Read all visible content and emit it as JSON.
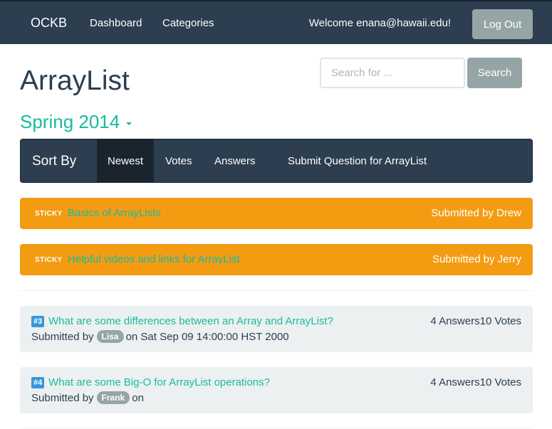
{
  "navbar": {
    "brand": "OCKB",
    "links": [
      "Dashboard",
      "Categories"
    ],
    "welcome": "Welcome enana@hawaii.edu!",
    "logout_label": "Log Out"
  },
  "search": {
    "placeholder": "Search for ...",
    "button_label": "Search"
  },
  "page": {
    "title": "ArrayList",
    "semester": "Spring 2014"
  },
  "sort_bar": {
    "label": "Sort By",
    "options": [
      "Newest",
      "Votes",
      "Answers"
    ],
    "active": "Newest",
    "submit_link": "Submit Question for ArrayList"
  },
  "sticky_posts": [
    {
      "badge": "STICKY",
      "title": "Basics of ArrayLists",
      "submitted": "Submitted by Drew"
    },
    {
      "badge": "STICKY",
      "title": "Helpful videos and links for ArrayList",
      "submitted": "Submitted by Jerry"
    }
  ],
  "questions": [
    {
      "number": "#3",
      "title": "What are some differences between an Array and ArrayList?",
      "counts": "4 Answers10 Votes",
      "submitted_prefix": "Submitted by",
      "user": "Lisa",
      "submitted_suffix": "on Sat Sep 09 14:00:00 HST 2000"
    },
    {
      "number": "#4",
      "title": "What are some Big-O for ArrayList operations?",
      "counts": "4 Answers10 Votes",
      "submitted_prefix": "Submitted by",
      "user": "Frank",
      "submitted_suffix": "on"
    }
  ],
  "colors": {
    "navbar": "#2c3e50",
    "accent_link": "#18bc9c",
    "sticky": "#f39c12",
    "button_gray": "#95a5a6",
    "question_bg": "#ecf0f1",
    "number_badge": "#3498db"
  }
}
